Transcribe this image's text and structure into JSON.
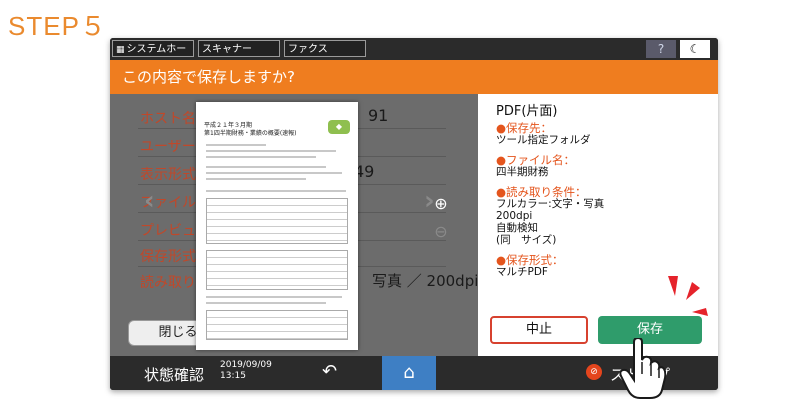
{
  "step_label": "STEP５",
  "tabs": [
    {
      "label": "システムホーム",
      "icon": "grid-icon"
    },
    {
      "label": "スキャナー"
    },
    {
      "label": "ファクス"
    }
  ],
  "help_label": "?",
  "title": "この内容で保存しますか?",
  "form": {
    "host_label": "ホスト名",
    "host_value_tail": "91",
    "user_label": "ユーザー名",
    "display_label": "表示形式",
    "display_value_tail": "49",
    "filename_label": "ファイル名",
    "preview_label": "プレビュー",
    "save_format_label": "保存形式",
    "read_cond_label": "読み取り条",
    "read_cond_value_tail": "写真 ／ 200dpi",
    "close_label": "閉じる"
  },
  "document_preview": {
    "title_line1": "平成２１年３月期",
    "title_line2": "第1四半期財務・業績の概要(速報)"
  },
  "panel": {
    "heading": "PDF(片面)",
    "items": [
      {
        "label": "●保存先：",
        "values": [
          "ツール指定フォルダ"
        ]
      },
      {
        "label": "●ファイル名：",
        "values": [
          "四半期財務"
        ]
      },
      {
        "label": "●読み取り条件：",
        "values": [
          "フルカラー:文字・写真",
          "200dpi",
          "自動検知",
          "(同　サイズ)"
        ]
      },
      {
        "label": "●保存形式：",
        "values": [
          "マルチPDF"
        ]
      }
    ],
    "cancel_label": "中止",
    "save_label": "保存"
  },
  "bottom": {
    "status_label": "状態確認",
    "date": "2019/09/09",
    "time": "13:15",
    "stop_label": "ストップ"
  },
  "colors": {
    "accent_orange": "#ef7d1f",
    "save_green": "#2f9c6b",
    "cancel_red": "#d7412f",
    "home_blue": "#3e7fc4"
  }
}
